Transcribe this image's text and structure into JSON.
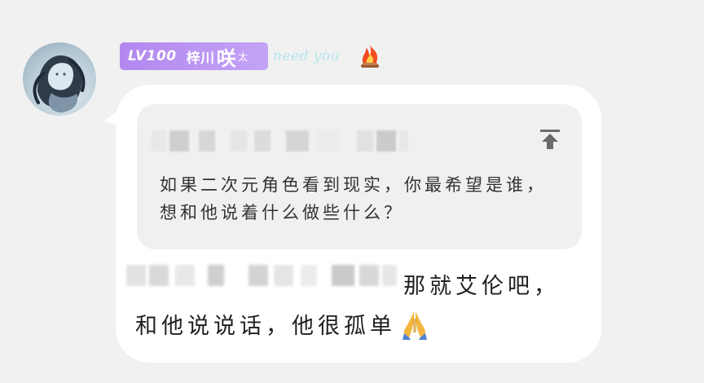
{
  "user": {
    "level": "LV100",
    "name_prefix": "梓川",
    "name_main": "咲",
    "name_suffix": "太",
    "tagline": "need you"
  },
  "reply": {
    "quoted_text": "如果二次元角色看到现实，你最希望是谁，想和他说着什么做些什么？"
  },
  "message": {
    "line1": "那就艾伦吧，",
    "line2": "和他说说话，他很孤单"
  },
  "icons": {
    "fire": "fire-icon",
    "pin": "pin-top-icon",
    "pray": "praying-hands-icon"
  },
  "colors": {
    "badge": "#b287ef",
    "tagline": "#b6e5ea",
    "bubble": "#ffffff",
    "reply_bg": "#f0f0f0"
  }
}
